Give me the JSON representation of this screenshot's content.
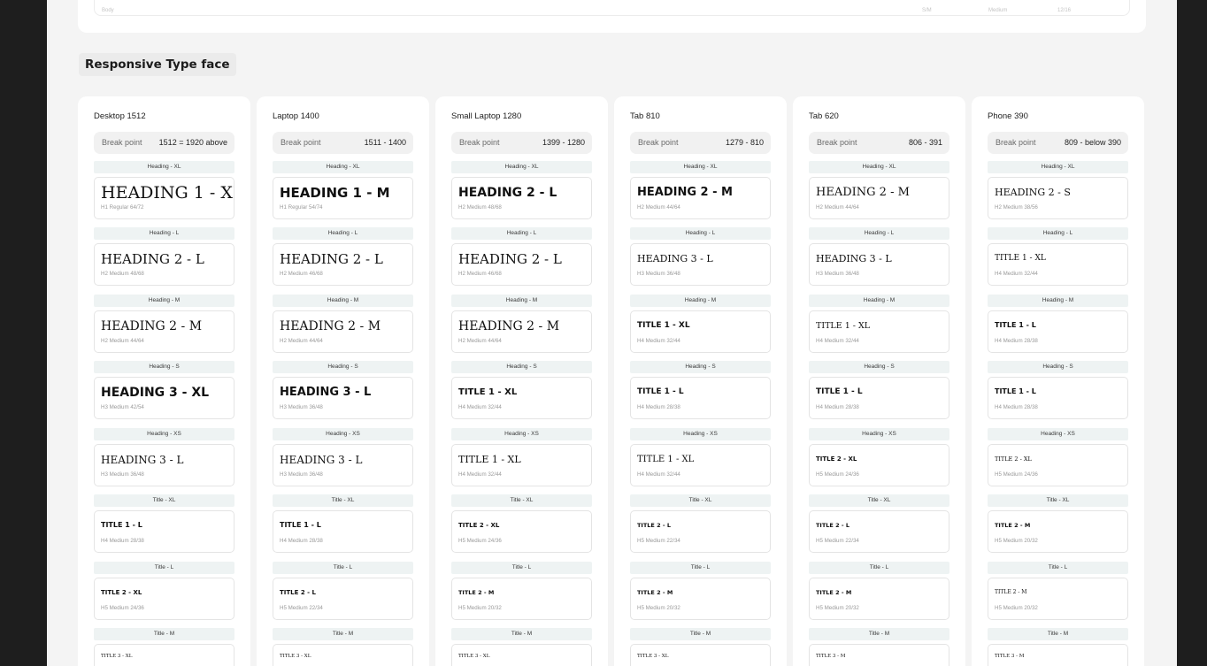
{
  "section_title": "Responsive Type face",
  "previous_row": [
    "Body",
    "S/M",
    "Medium",
    "12/16"
  ],
  "columns": [
    {
      "title": "Desktop 1512",
      "breakpoint_label": "Break point",
      "breakpoint_value": "1512 = 1920 above",
      "rows": [
        {
          "level": "Heading - XL",
          "sample": "HEADING 1 - XL",
          "spec": "H1 Regular 64/72"
        },
        {
          "level": "Heading - L",
          "sample": "HEADING 2 - L",
          "spec": "H2 Medium 48/68"
        },
        {
          "level": "Heading - M",
          "sample": "HEADING 2 - M",
          "spec": "H2 Medium 44/64"
        },
        {
          "level": "Heading - S",
          "sample": "HEADING 3 - XL",
          "spec": "H3 Medium 42/54"
        },
        {
          "level": "Heading - XS",
          "sample": "HEADING 3 - L",
          "spec": "H3 Medium 36/48"
        },
        {
          "level": "Title - XL",
          "sample": "TITLE 1 - L",
          "spec": "H4 Medium 28/38"
        },
        {
          "level": "Title - L",
          "sample": "TITLE 2 - XL",
          "spec": "H5 Medium 24/36"
        },
        {
          "level": "Title - M",
          "sample": "TITLE 3 - XL",
          "spec": ""
        }
      ]
    },
    {
      "title": "Laptop 1400",
      "breakpoint_label": "Break point",
      "breakpoint_value": "1511 - 1400",
      "rows": [
        {
          "level": "Heading - XL",
          "sample": "HEADING 1 - M",
          "spec": "H1 Regular 54/74"
        },
        {
          "level": "Heading - L",
          "sample": "HEADING 2 - L",
          "spec": "H2 Medium 46/68"
        },
        {
          "level": "Heading - M",
          "sample": "HEADING 2 - M",
          "spec": "H2 Medium 44/64"
        },
        {
          "level": "Heading - S",
          "sample": "HEADING 3 - L",
          "spec": "H3 Medium 36/48"
        },
        {
          "level": "Heading - XS",
          "sample": "HEADING 3 - L",
          "spec": "H3 Medium 36/48"
        },
        {
          "level": "Title - XL",
          "sample": "TITLE 1 - L",
          "spec": "H4 Medium 28/38"
        },
        {
          "level": "Title - L",
          "sample": "TITLE 2 - L",
          "spec": "H5 Medium 22/34"
        },
        {
          "level": "Title - M",
          "sample": "TITLE 3 - XL",
          "spec": ""
        }
      ]
    },
    {
      "title": "Small Laptop 1280",
      "breakpoint_label": "Break point",
      "breakpoint_value": "1399 - 1280",
      "rows": [
        {
          "level": "Heading - XL",
          "sample": "HEADING 2 - L",
          "spec": "H2 Medium 48/68"
        },
        {
          "level": "Heading - L",
          "sample": "HEADING 2 - L",
          "spec": "H2 Medium 46/68"
        },
        {
          "level": "Heading - M",
          "sample": "HEADING 2 - M",
          "spec": "H2 Medium 44/64"
        },
        {
          "level": "Heading - S",
          "sample": "TITLE 1 - XL",
          "spec": "H4 Medium 32/44"
        },
        {
          "level": "Heading - XS",
          "sample": "TITLE 1 - XL",
          "spec": "H4 Medium 32/44"
        },
        {
          "level": "Title - XL",
          "sample": "TITLE 2 - XL",
          "spec": "H5 Medium 24/36"
        },
        {
          "level": "Title - L",
          "sample": "TITLE 2 - M",
          "spec": "H5 Medium 20/32"
        },
        {
          "level": "Title - M",
          "sample": "TITLE 3 - XL",
          "spec": ""
        }
      ]
    },
    {
      "title": "Tab 810",
      "breakpoint_label": "Break point",
      "breakpoint_value": "1279 - 810",
      "rows": [
        {
          "level": "Heading - XL",
          "sample": "HEADING 2 - M",
          "spec": "H2 Medium 44/64"
        },
        {
          "level": "Heading - L",
          "sample": "HEADING 3 - L",
          "spec": "H3 Medium 36/48"
        },
        {
          "level": "Heading - M",
          "sample": "TITLE 1 - XL",
          "spec": "H4 Medium 32/44"
        },
        {
          "level": "Heading - S",
          "sample": "TITLE 1 - L",
          "spec": "H4 Medium 28/38"
        },
        {
          "level": "Heading - XS",
          "sample": "TITLE 1 - XL",
          "spec": "H4 Medium 32/44"
        },
        {
          "level": "Title - XL",
          "sample": "TITLE 2 - L",
          "spec": "H5 Medium 22/34"
        },
        {
          "level": "Title - L",
          "sample": "TITLE 2 - M",
          "spec": "H5 Medium 20/32"
        },
        {
          "level": "Title - M",
          "sample": "TITLE 3 - XL",
          "spec": ""
        }
      ]
    },
    {
      "title": "Tab 620",
      "breakpoint_label": "Break point",
      "breakpoint_value": "806 - 391",
      "rows": [
        {
          "level": "Heading - XL",
          "sample": "HEADING 2 - M",
          "spec": "H2 Medium 44/64"
        },
        {
          "level": "Heading - L",
          "sample": "HEADING 3 - L",
          "spec": "H3 Medium 36/48"
        },
        {
          "level": "Heading - M",
          "sample": "TITLE 1 - XL",
          "spec": "H4 Medium 32/44"
        },
        {
          "level": "Heading - S",
          "sample": "TITLE 1 - L",
          "spec": "H4 Medium 28/38"
        },
        {
          "level": "Heading - XS",
          "sample": "TITLE 2 - XL",
          "spec": "H5 Medium 24/36"
        },
        {
          "level": "Title - XL",
          "sample": "TITLE 2 - L",
          "spec": "H5 Medium 22/34"
        },
        {
          "level": "Title - L",
          "sample": "TITLE 2 - M",
          "spec": "H5 Medium 20/32"
        },
        {
          "level": "Title - M",
          "sample": "TITLE 3 - M",
          "spec": ""
        }
      ]
    },
    {
      "title": "Phone 390",
      "breakpoint_label": "Break point",
      "breakpoint_value": "809 - below 390",
      "rows": [
        {
          "level": "Heading - XL",
          "sample": "HEADING 2 - S",
          "spec": "H2 Medium 38/56"
        },
        {
          "level": "Heading - L",
          "sample": "TITLE 1 - XL",
          "spec": "H4 Medium 32/44"
        },
        {
          "level": "Heading - M",
          "sample": "TITLE 1 - L",
          "spec": "H4 Medium 28/38"
        },
        {
          "level": "Heading - S",
          "sample": "TITLE 1 - L",
          "spec": "H4 Medium 28/38"
        },
        {
          "level": "Heading - XS",
          "sample": "TITLE 2 - XL",
          "spec": "H5 Medium 24/36"
        },
        {
          "level": "Title - XL",
          "sample": "TITLE 2 - M",
          "spec": "H5 Medium 20/32"
        },
        {
          "level": "Title - L",
          "sample": "TITLE 2 - M",
          "spec": "H5 Medium 20/32"
        },
        {
          "level": "Title - M",
          "sample": "TITLE 3 - M",
          "spec": ""
        }
      ]
    }
  ]
}
